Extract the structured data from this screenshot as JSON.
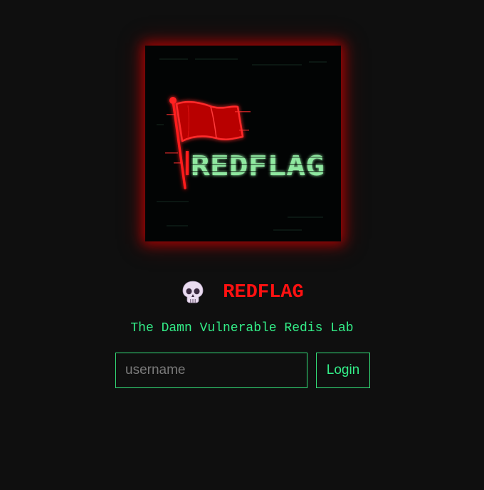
{
  "logo": {
    "image_text": "REDFLAG",
    "colors": {
      "flag": "#ff1a1a",
      "text": "#8fe8a0",
      "glow": "#cc0000",
      "background": "#020404"
    }
  },
  "heading": {
    "icon": "skull-icon",
    "title": "REDFLAG"
  },
  "subtitle": "The Damn Vulnerable Redis Lab",
  "login_form": {
    "username_placeholder": "username",
    "username_value": "",
    "login_label": "Login"
  },
  "colors": {
    "accent_green": "#33ee88",
    "title_red": "#ff1111",
    "page_background": "#0f0f0f"
  }
}
